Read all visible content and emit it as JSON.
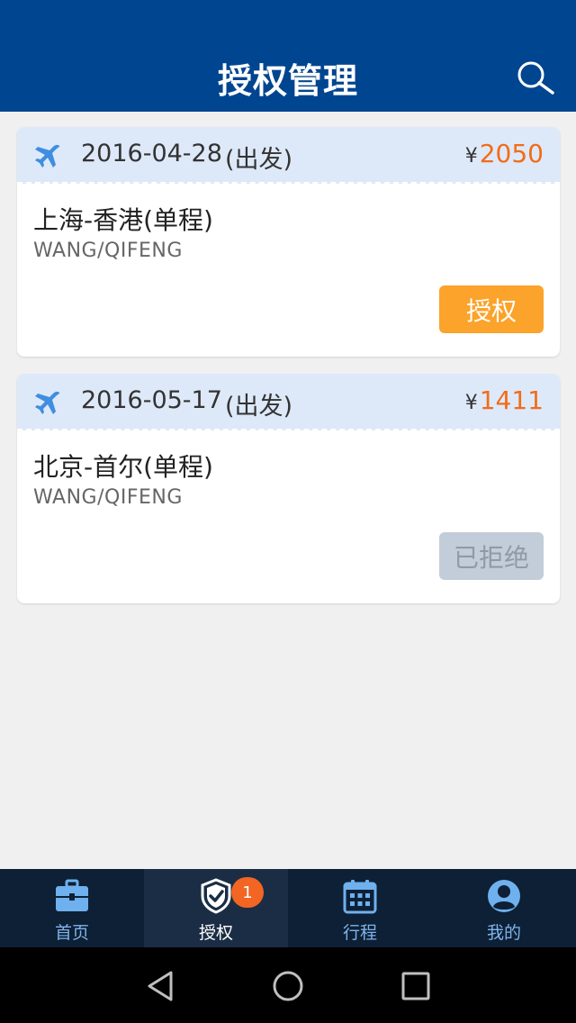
{
  "header": {
    "title": "授权管理",
    "search_icon": "search-icon"
  },
  "trips": [
    {
      "date": "2016-04-28",
      "depart_label": "(出发)",
      "currency": "¥",
      "price": "2050",
      "route": "上海-香港(单程)",
      "passenger": "WANG/QIFENG",
      "action_label": "授权",
      "action_state": "approve",
      "icon": "plane-icon"
    },
    {
      "date": "2016-05-17",
      "depart_label": "(出发)",
      "currency": "¥",
      "price": "1411",
      "route": "北京-首尔(单程)",
      "passenger": "WANG/QIFENG",
      "action_label": "已拒绝",
      "action_state": "rejected",
      "icon": "plane-icon"
    }
  ],
  "tabbar": {
    "items": [
      {
        "label": "首页",
        "icon": "briefcase-icon",
        "active": false
      },
      {
        "label": "授权",
        "icon": "shield-check-icon",
        "active": true,
        "badge": "1"
      },
      {
        "label": "行程",
        "icon": "calendar-icon",
        "active": false
      },
      {
        "label": "我的",
        "icon": "user-icon",
        "active": false
      }
    ]
  },
  "colors": {
    "header_bg": "#00458f",
    "price": "#f26c1a",
    "approve_button": "#fba32a",
    "rejected_button": "#c3cdd9",
    "tabbar_bg": "#0d2035",
    "badge": "#f26522"
  }
}
